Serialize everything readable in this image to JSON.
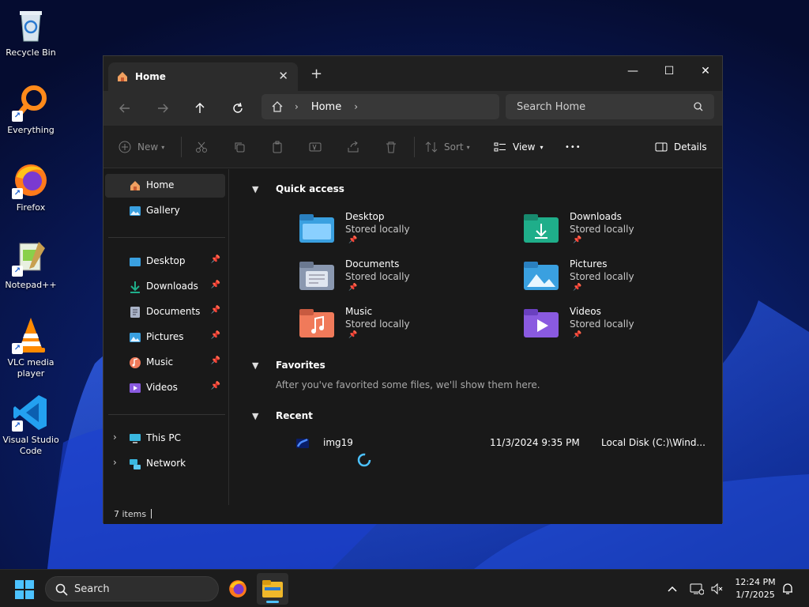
{
  "desktop": {
    "icons": [
      {
        "label": "Recycle Bin",
        "icon": "recycle-bin-icon"
      },
      {
        "label": "Everything",
        "icon": "everything-icon"
      },
      {
        "label": "Firefox",
        "icon": "firefox-icon"
      },
      {
        "label": "Notepad++",
        "icon": "notepad-plus-plus-icon"
      },
      {
        "label": "VLC media player",
        "icon": "vlc-icon"
      },
      {
        "label": "Visual Studio Code",
        "icon": "vscode-icon"
      }
    ]
  },
  "explorer": {
    "tab": {
      "label": "Home",
      "close": "✕",
      "new_tab": "+"
    },
    "window_controls": {
      "minimize": "—",
      "maximize": "☐",
      "close": "✕"
    },
    "address": {
      "crumbs": [
        "Home"
      ],
      "separator": "›"
    },
    "search": {
      "placeholder": "Search Home"
    },
    "toolbar": {
      "new_label": "New",
      "sort_label": "Sort",
      "view_label": "View",
      "more_label": "•••",
      "details_label": "Details"
    },
    "sidebar": {
      "top": [
        {
          "label": "Home",
          "icon": "home-icon",
          "selected": true
        },
        {
          "label": "Gallery",
          "icon": "gallery-icon"
        }
      ],
      "pinned": [
        {
          "label": "Desktop",
          "icon": "desktop-folder-icon"
        },
        {
          "label": "Downloads",
          "icon": "downloads-icon"
        },
        {
          "label": "Documents",
          "icon": "documents-icon"
        },
        {
          "label": "Pictures",
          "icon": "pictures-icon"
        },
        {
          "label": "Music",
          "icon": "music-icon"
        },
        {
          "label": "Videos",
          "icon": "videos-icon"
        }
      ],
      "bottom": [
        {
          "label": "This PC",
          "icon": "this-pc-icon"
        },
        {
          "label": "Network",
          "icon": "network-icon"
        }
      ]
    },
    "quick_access": {
      "title": "Quick access",
      "items": [
        {
          "name": "Desktop",
          "sub": "Stored locally",
          "color": "#3aa0e0"
        },
        {
          "name": "Downloads",
          "sub": "Stored locally",
          "color": "#1fae8a"
        },
        {
          "name": "Documents",
          "sub": "Stored locally",
          "color": "#8a98b0"
        },
        {
          "name": "Pictures",
          "sub": "Stored locally",
          "color": "#3aa0e0"
        },
        {
          "name": "Music",
          "sub": "Stored locally",
          "color": "#f07a5a"
        },
        {
          "name": "Videos",
          "sub": "Stored locally",
          "color": "#8a5ae0"
        }
      ]
    },
    "favorites": {
      "title": "Favorites",
      "empty_text": "After you've favorited some files, we'll show them here."
    },
    "recent": {
      "title": "Recent",
      "items": [
        {
          "name": "img19",
          "date": "11/3/2024 9:35 PM",
          "location": "Local Disk (C:)\\Wind..."
        }
      ]
    },
    "status": {
      "items_count": "7 items"
    }
  },
  "taskbar": {
    "search_label": "Search",
    "clock": {
      "time": "12:24 PM",
      "date": "1/7/2025"
    }
  },
  "colors": {
    "accent": "#4cc2ff",
    "window_bg": "#191919",
    "chrome_bg": "#202020"
  }
}
